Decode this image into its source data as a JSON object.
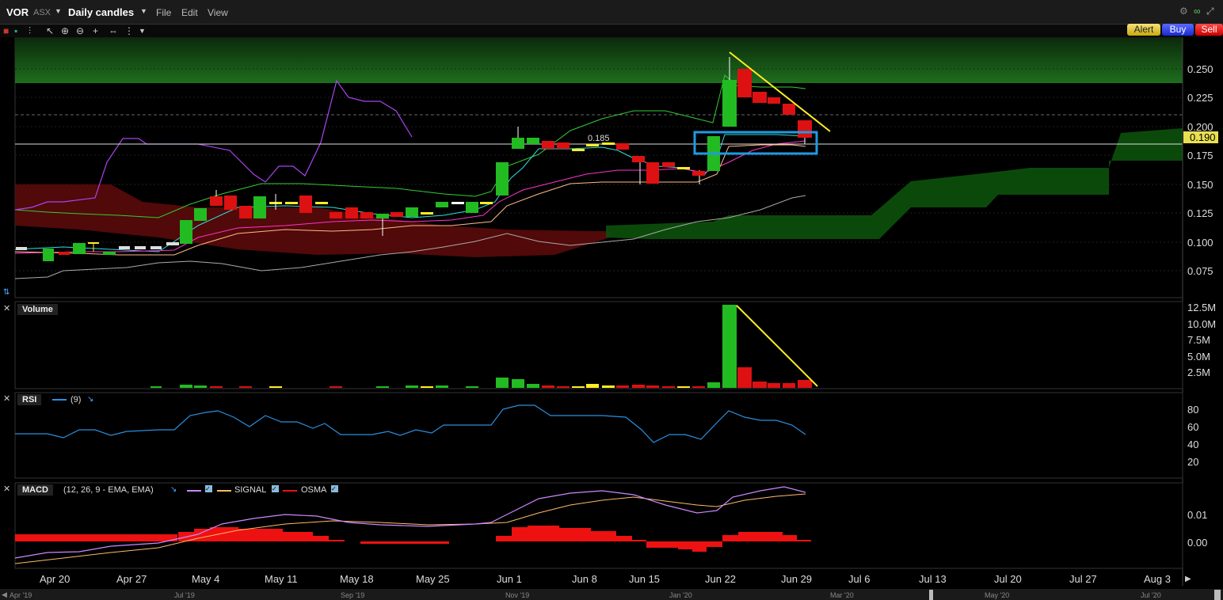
{
  "header": {
    "symbol": "VOR",
    "exchange": "ASX",
    "timeframe": "Daily candles",
    "menu": [
      "File",
      "Edit",
      "View"
    ],
    "buttons": {
      "alert": "Alert",
      "buy": "Buy",
      "sell": "Sell"
    }
  },
  "price_panel": {
    "y_ticks": [
      "0.250",
      "0.225",
      "0.200",
      "0.175",
      "0.150",
      "0.125",
      "0.100",
      "0.075"
    ],
    "last_price": "0.190",
    "annotation": "0.185"
  },
  "volume_panel": {
    "label": "Volume",
    "y_ticks": [
      "12.5M",
      "10.0M",
      "7.5M",
      "5.0M",
      "2.5M"
    ]
  },
  "rsi_panel": {
    "label": "RSI",
    "param": "(9)",
    "y_ticks": [
      "80",
      "60",
      "40",
      "20"
    ]
  },
  "macd_panel": {
    "label": "MACD",
    "param": "(12, 26, 9 - EMA, EMA)",
    "signal": "SIGNAL",
    "osma": "OSMA",
    "y_ticks": [
      "0.01",
      "0.00"
    ]
  },
  "x_axis": [
    "Apr 20",
    "Apr 27",
    "May 4",
    "May 11",
    "May 18",
    "May 25",
    "Jun 1",
    "Jun 8",
    "Jun 15",
    "Jun 22",
    "Jun 29",
    "Jul 6",
    "Jul 13",
    "Jul 20",
    "Jul 27",
    "Aug 3"
  ],
  "scroll_labels": [
    "Apr '19",
    "Jul '19",
    "Sep '19",
    "Nov '19",
    "Jan '20",
    "Mar '20",
    "May '20",
    "Jul '20"
  ],
  "colors": {
    "up": "#22bb22",
    "down": "#dd1111",
    "highlight": "#1e9be0",
    "trend": "#ffee22",
    "rsi": "#2a8fe0"
  }
}
